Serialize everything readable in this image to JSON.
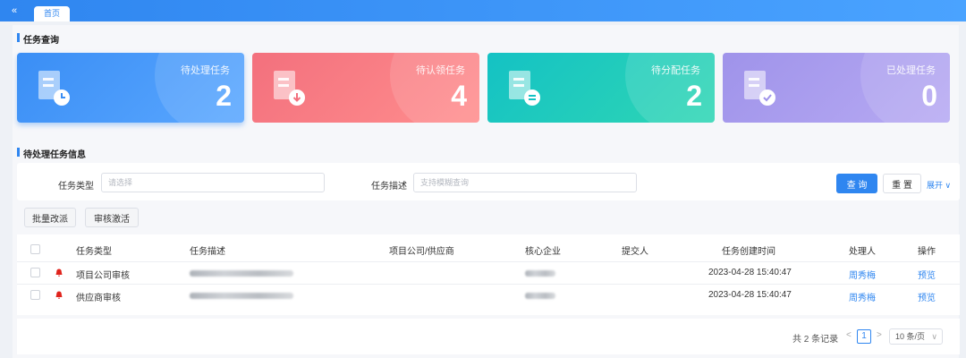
{
  "header": {
    "collapse_icon": "«",
    "home_tab": "首页"
  },
  "query_section": {
    "title": "任务查询"
  },
  "cards": [
    {
      "label": "待处理任务",
      "value": "2",
      "icon": "document-clock-icon",
      "color": "#3a8ef5"
    },
    {
      "label": "待认领任务",
      "value": "4",
      "icon": "document-download-icon",
      "color": "#f3707d"
    },
    {
      "label": "待分配任务",
      "value": "2",
      "icon": "document-list-icon",
      "color": "#14c2c4"
    },
    {
      "label": "已处理任务",
      "value": "0",
      "icon": "document-check-icon",
      "color": "#9f93ea"
    }
  ],
  "pending_section": {
    "title": "待处理任务信息"
  },
  "filters": {
    "type_label": "任务类型",
    "type_placeholder": "请选择",
    "desc_label": "任务描述",
    "desc_placeholder": "支持模糊查询",
    "query_button": "查 询",
    "reset_button": "重 置",
    "expand_link": "展开"
  },
  "actions": {
    "batch_reassign": "批量改派",
    "audit_activate": "审核激活"
  },
  "table": {
    "columns": [
      "任务类型",
      "任务描述",
      "项目公司/供应商",
      "核心企业",
      "提交人",
      "任务创建时间",
      "处理人",
      "操作"
    ],
    "rows": [
      {
        "type": "项目公司审核",
        "created": "2023-04-28 15:40:47",
        "handler": "周秀梅",
        "action": "预览"
      },
      {
        "type": "供应商审核",
        "created": "2023-04-28 15:40:47",
        "handler": "周秀梅",
        "action": "预览"
      }
    ]
  },
  "pagination": {
    "total": "共 2 条记录",
    "prev": "<",
    "current": "1",
    "next": ">",
    "page_size": "10 条/页"
  }
}
